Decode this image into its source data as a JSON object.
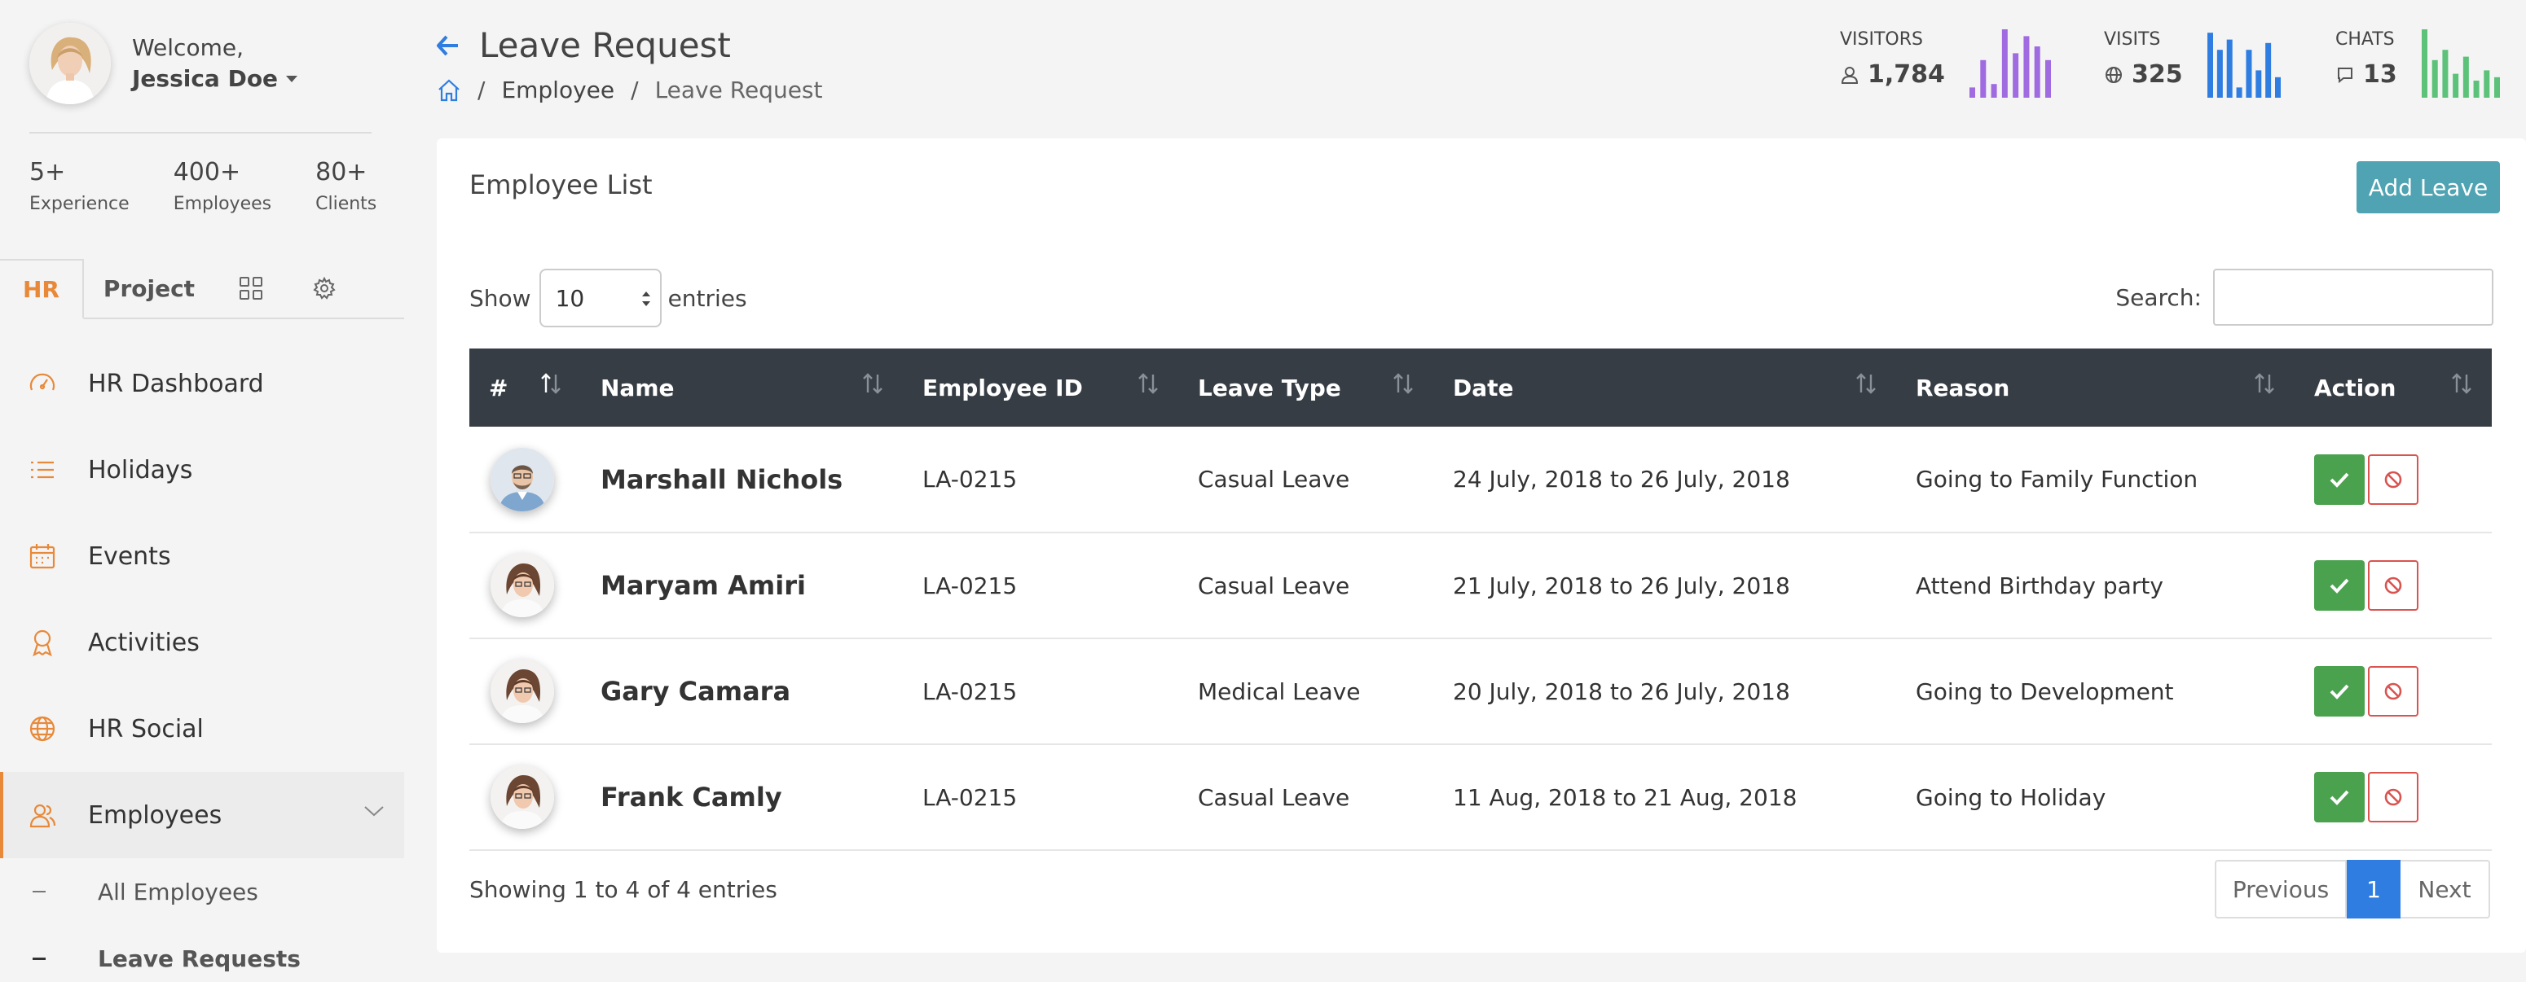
{
  "user": {
    "greeting": "Welcome,",
    "name": "Jessica Doe"
  },
  "stats": [
    {
      "value": "5+",
      "label": "Experience"
    },
    {
      "value": "400+",
      "label": "Employees"
    },
    {
      "value": "80+",
      "label": "Clients"
    }
  ],
  "tabs": {
    "hr": "HR",
    "project": "Project"
  },
  "menu": [
    {
      "label": "HR Dashboard",
      "icon": "dashboard-icon"
    },
    {
      "label": "Holidays",
      "icon": "list-icon"
    },
    {
      "label": "Events",
      "icon": "calendar-icon"
    },
    {
      "label": "Activities",
      "icon": "award-icon"
    },
    {
      "label": "HR Social",
      "icon": "globe-icon"
    },
    {
      "label": "Employees",
      "icon": "users-icon"
    }
  ],
  "submenu": [
    "All Employees",
    "Leave Requests"
  ],
  "page": {
    "title": "Leave Request",
    "breadcrumb": [
      "Employee",
      "Leave Request"
    ]
  },
  "header_stats": [
    {
      "label": "VISITORS",
      "value": "1,784",
      "color": "#a06ae0",
      "bars": [
        0.15,
        0.55,
        0.2,
        1.0,
        0.65,
        0.9,
        0.75,
        0.55
      ]
    },
    {
      "label": "VISITS",
      "value": "325",
      "color": "#2f7de1",
      "bars": [
        0.95,
        0.7,
        0.85,
        0.15,
        0.7,
        0.4,
        0.8,
        0.3
      ]
    },
    {
      "label": "CHATS",
      "value": "13",
      "color": "#5cc27a",
      "bars": [
        1.0,
        0.55,
        0.7,
        0.35,
        0.6,
        0.25,
        0.4,
        0.3
      ]
    }
  ],
  "card": {
    "title": "Employee List",
    "add_button": "Add Leave",
    "show_label": "Show",
    "show_value": "10",
    "entries_label": "entries",
    "search_label": "Search:",
    "columns": [
      "#",
      "Name",
      "Employee ID",
      "Leave Type",
      "Date",
      "Reason",
      "Action"
    ],
    "rows": [
      {
        "name": "Marshall Nichols",
        "id": "LA-0215",
        "type": "Casual Leave",
        "date": "24 July, 2018 to 26 July, 2018",
        "reason": "Going to Family Function",
        "avatar": "male"
      },
      {
        "name": "Maryam Amiri",
        "id": "LA-0215",
        "type": "Casual Leave",
        "date": "21 July, 2018 to 26 July, 2018",
        "reason": "Attend Birthday party",
        "avatar": "female"
      },
      {
        "name": "Gary Camara",
        "id": "LA-0215",
        "type": "Medical Leave",
        "date": "20 July, 2018 to 26 July, 2018",
        "reason": "Going to Development",
        "avatar": "female"
      },
      {
        "name": "Frank Camly",
        "id": "LA-0215",
        "type": "Casual Leave",
        "date": "11 Aug, 2018 to 21 Aug, 2018",
        "reason": "Going to Holiday",
        "avatar": "female"
      }
    ],
    "showing": "Showing 1 to 4 of 4 entries",
    "pagination": {
      "previous": "Previous",
      "current": "1",
      "next": "Next"
    }
  },
  "colors": {
    "accent": "#e8893a",
    "primary": "#2f7de1",
    "success": "#4aa14e",
    "danger": "#d9534f",
    "button": "#4fa3b2",
    "table_header": "#363d44"
  }
}
